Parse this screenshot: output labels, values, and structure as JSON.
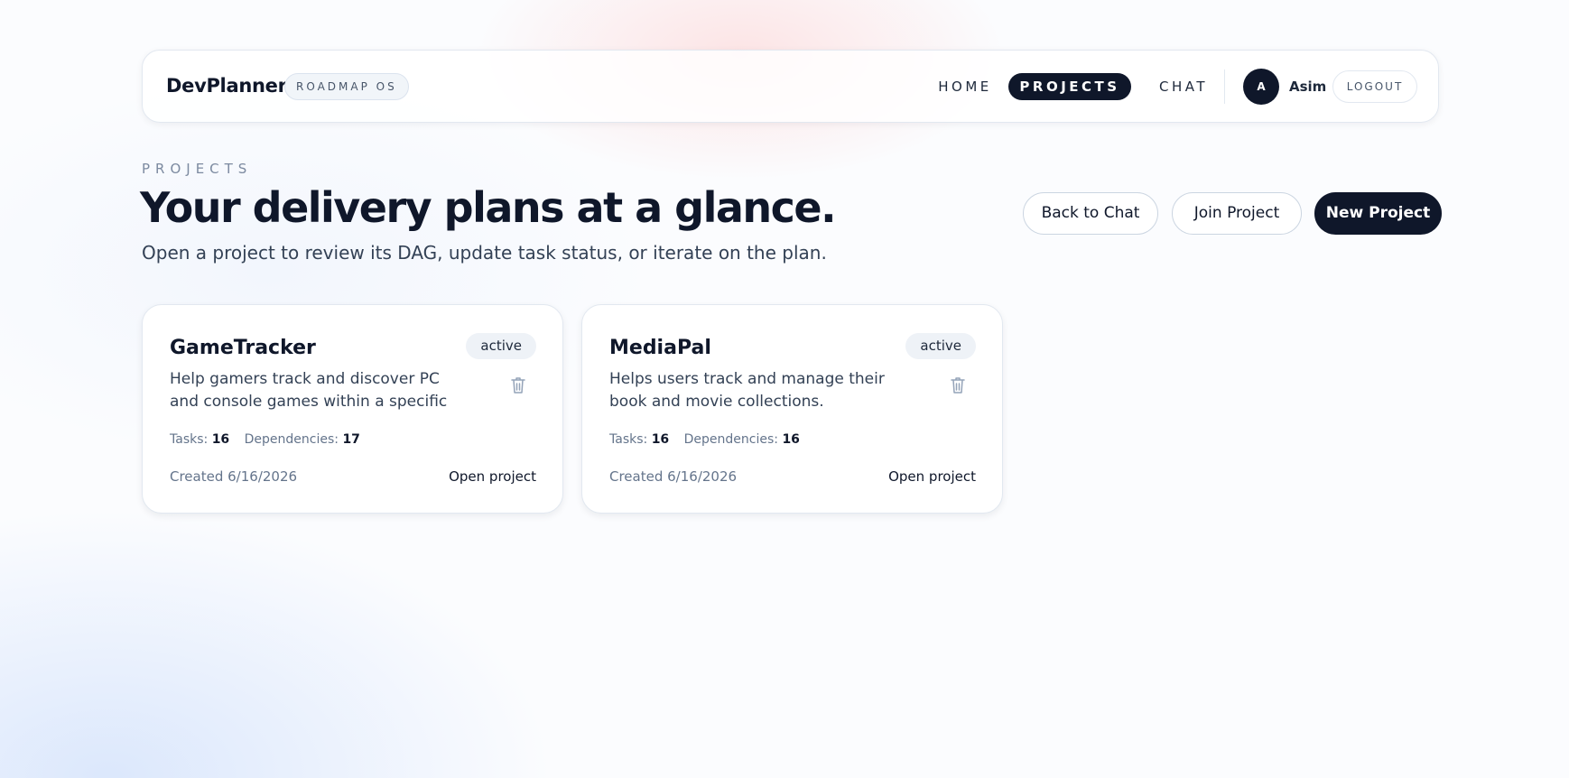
{
  "brand": {
    "name": "DevPlanner",
    "tag": "ROADMAP OS"
  },
  "nav": {
    "home": "HOME",
    "projects": "PROJECTS",
    "chat": "CHAT"
  },
  "user": {
    "initial": "A",
    "name": "Asim",
    "logout": "LOGOUT"
  },
  "header": {
    "eyebrow": "PROJECTS",
    "title": "Your delivery plans at a glance.",
    "subtitle": "Open a project to review its DAG, update task status, or iterate on the plan."
  },
  "actions": {
    "back_to_chat": "Back to Chat",
    "join_project": "Join Project",
    "new_project": "New Project"
  },
  "colors": {
    "primary": "#0f172a",
    "muted": "#64748b",
    "badge_bg": "#eef2f7"
  },
  "projects": [
    {
      "name": "GameTracker",
      "status": "active",
      "description": "Help gamers track and discover PC and console games within a specific",
      "tasks_label": "Tasks:",
      "tasks": "16",
      "deps_label": "Dependencies:",
      "dependencies": "17",
      "created": "Created 6/16/2026",
      "open": "Open project",
      "delete_icon": "trash-icon"
    },
    {
      "name": "MediaPal",
      "status": "active",
      "description": "Helps users track and manage their book and movie collections.",
      "tasks_label": "Tasks:",
      "tasks": "16",
      "deps_label": "Dependencies:",
      "dependencies": "16",
      "created": "Created 6/16/2026",
      "open": "Open project",
      "delete_icon": "trash-icon"
    }
  ]
}
